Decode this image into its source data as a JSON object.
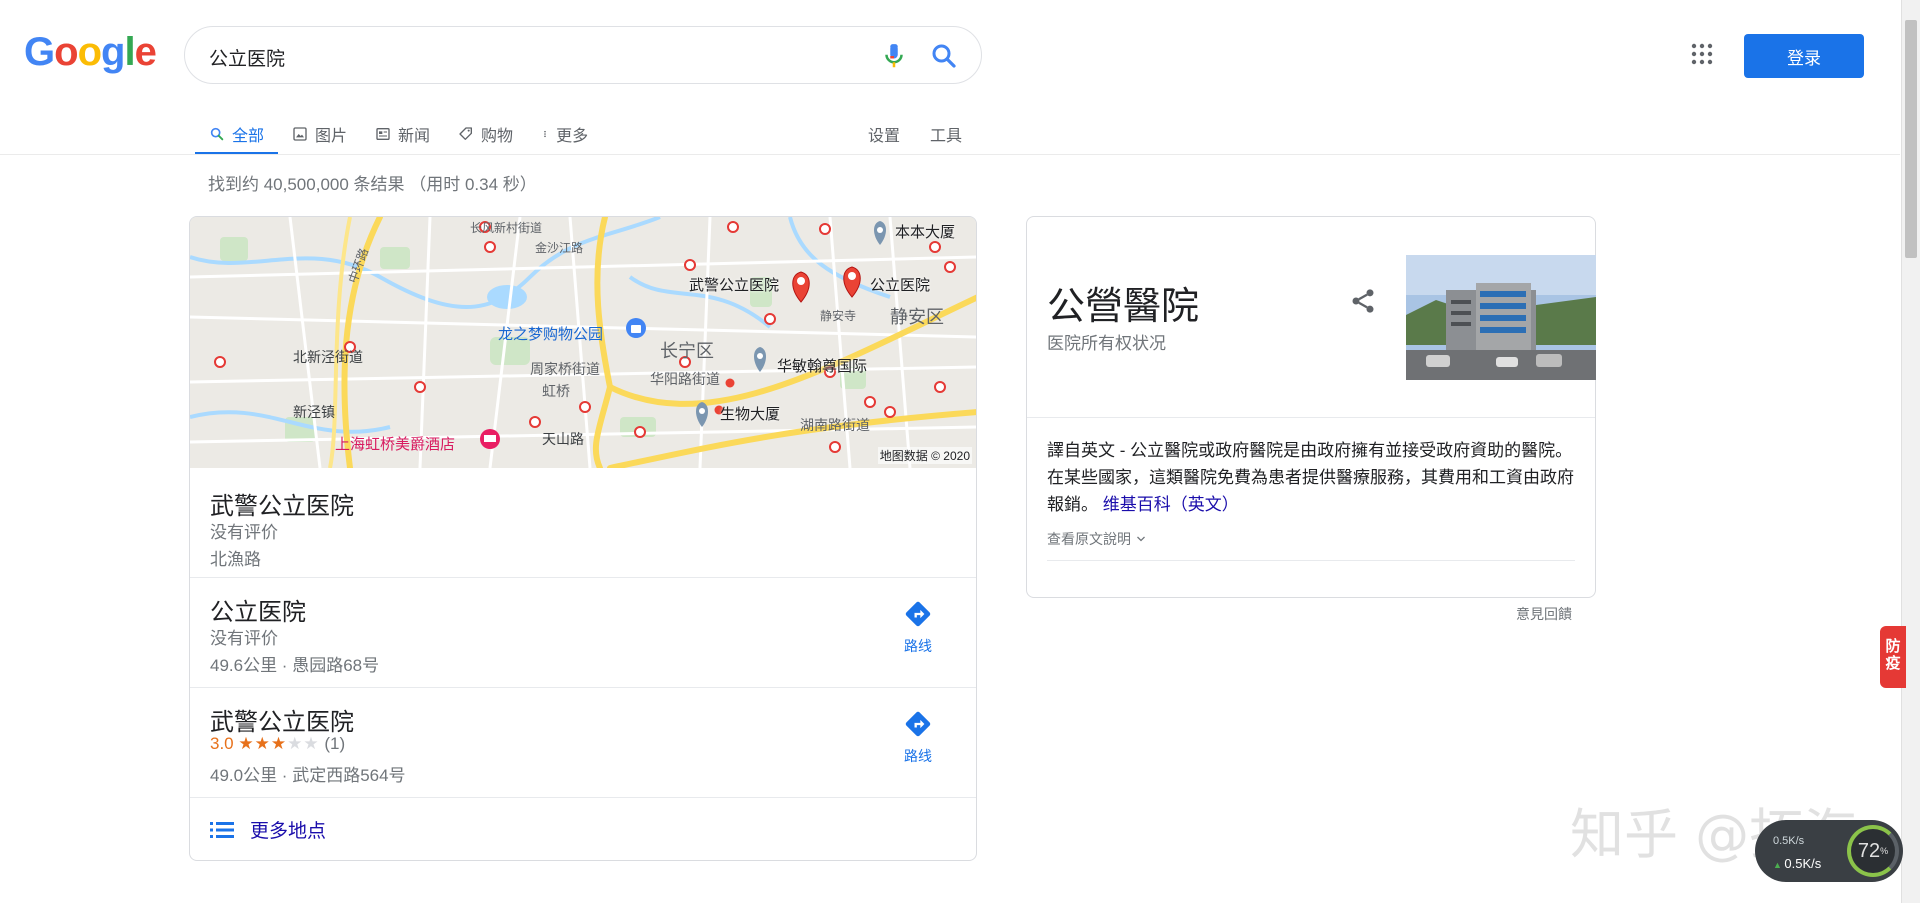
{
  "search": {
    "query": "公立医院"
  },
  "header": {
    "logo_letters": [
      "G",
      "o",
      "o",
      "g",
      "l",
      "e"
    ],
    "logo_colors": [
      "#4285f4",
      "#ea4335",
      "#fbbc05",
      "#4285f4",
      "#34a853",
      "#ea4335"
    ],
    "signin_label": "登录"
  },
  "tabs": [
    {
      "label": "全部",
      "icon": "search-icon",
      "active": true
    },
    {
      "label": "图片",
      "icon": "image-icon"
    },
    {
      "label": "新闻",
      "icon": "news-icon"
    },
    {
      "label": "购物",
      "icon": "tag-icon"
    },
    {
      "label": "更多",
      "icon": "more-vert-icon"
    }
  ],
  "tools": {
    "settings": "设置",
    "tools": "工具"
  },
  "result_stats": "找到约 40,500,000 条结果 （用时 0.34 秒）",
  "map": {
    "labels": {
      "changfeng": "长风新村街道",
      "jinshajiang": "金沙江路",
      "benben": "本本大厦",
      "zhonghuan": "中环路",
      "wujing_hospital": "武警公立医院",
      "gongli_hospital": "公立医院",
      "jingansi": "静安寺",
      "jingan": "静安区",
      "longzhimeng": "龙之梦购物公园",
      "changning": "长宁区",
      "beixinjing": "北新泾街道",
      "zhoujiaqiao": "周家桥街道",
      "huamin": "华敏翰尊国际",
      "huayang": "华阳路街道",
      "hongqiao": "虹桥",
      "xinjing": "新泾镇",
      "shengwu": "生物大厦",
      "hunanlu": "湖南路街道",
      "hotel": "上海虹桥美爵酒店",
      "tianshan": "天山路"
    },
    "attribution": "地图数据 © 2020"
  },
  "places": [
    {
      "name": "武警公立医院",
      "rating_text": "没有评价",
      "address": "北漁路"
    },
    {
      "name": "公立医院",
      "rating_text": "没有评价",
      "address": "49.6公里 · 愚园路68号",
      "directions": "路线"
    },
    {
      "name": "武警公立医院",
      "rating": "3.0",
      "stars_on": "★★★",
      "stars_off": "★★",
      "reviews": "(1)",
      "address": "49.0公里 · 武定西路564号",
      "directions": "路线"
    }
  ],
  "more_places": "更多地点",
  "knowledge_panel": {
    "title": "公營醫院",
    "subtitle": "医院所有权状况",
    "description": "譯自英文 - 公立醫院或政府醫院是由政府擁有並接受政府資助的醫院。在某些國家，這類醫院免費為患者提供醫療服務，其費用和工資由政府報銷。",
    "source_link": "维基百科（英文）",
    "see_original": "查看原文說明",
    "feedback": "意見回饋"
  },
  "overlays": {
    "epidemic_badge": "防疫",
    "watermark": "知乎 @拓海",
    "net_down": "0.5K/s",
    "net_up": "0.5K/s",
    "net_percent": "72",
    "net_percent_unit": "%"
  },
  "colors": {
    "accent": "#1a73e8",
    "link": "#1a0dab",
    "pin_red": "#ea4335",
    "star": "#e7711b"
  }
}
